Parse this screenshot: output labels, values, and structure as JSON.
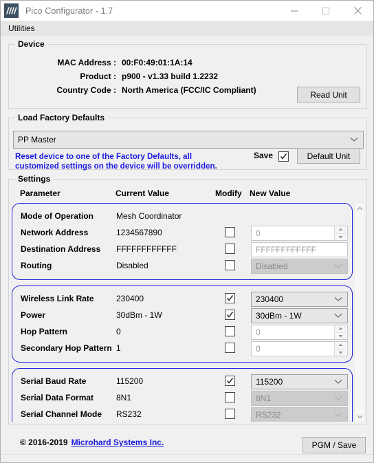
{
  "window": {
    "title": "Pico Configurator - 1.7",
    "logo_icon": "microhard-logo-icon",
    "minimize_icon": "minimize-icon",
    "maximize_icon": "maximize-icon",
    "close_icon": "close-icon"
  },
  "menubar": {
    "items": [
      {
        "label": "Utilities"
      }
    ]
  },
  "device": {
    "group_title": "Device",
    "rows": [
      {
        "label": "MAC Address :",
        "value": "00:F0:49:01:1A:14"
      },
      {
        "label": "Product :",
        "value": "p900 - v1.33 build 1.2232"
      },
      {
        "label": "Country Code :",
        "value": "North America (FCC/IC Compliant)"
      }
    ],
    "read_unit_button": "Read Unit"
  },
  "defaults": {
    "group_title": "Load Factory Defaults",
    "selected": "PP Master",
    "warning_line1": "Reset device to one of the Factory Defaults, all",
    "warning_line2": "customized settings on the device will be overridden.",
    "save_label": "Save",
    "save_checked": true,
    "default_unit_button": "Default Unit"
  },
  "settings": {
    "group_title": "Settings",
    "headers": {
      "parameter": "Parameter",
      "current_value": "Current Value",
      "modify": "Modify",
      "new_value": "New Value"
    },
    "groups": [
      {
        "rows": [
          {
            "name": "Mode of Operation",
            "current": "Mesh Coordinator",
            "has_modify": false,
            "checked": false,
            "control": "none",
            "new_value": ""
          },
          {
            "name": "Network Address",
            "current": "1234567890",
            "has_modify": true,
            "checked": false,
            "control": "spinner",
            "new_value": "0"
          },
          {
            "name": "Destination Address",
            "current": "FFFFFFFFFFFF",
            "has_modify": true,
            "checked": false,
            "control": "text",
            "new_value": "FFFFFFFFFFFF"
          },
          {
            "name": "Routing",
            "current": "Disabled",
            "has_modify": true,
            "checked": false,
            "control": "dropdown",
            "new_value": "Disabled"
          }
        ]
      },
      {
        "rows": [
          {
            "name": "Wireless Link Rate",
            "current": "230400",
            "has_modify": true,
            "checked": true,
            "control": "dropdown",
            "new_value": "230400"
          },
          {
            "name": "Power",
            "current": "30dBm - 1W",
            "has_modify": true,
            "checked": true,
            "control": "dropdown",
            "new_value": "30dBm - 1W"
          },
          {
            "name": "Hop Pattern",
            "current": "0",
            "has_modify": true,
            "checked": false,
            "control": "spinner",
            "new_value": "0"
          },
          {
            "name": "Secondary Hop Pattern",
            "current": "1",
            "has_modify": true,
            "checked": false,
            "control": "spinner",
            "new_value": "0"
          }
        ]
      },
      {
        "rows": [
          {
            "name": "Serial Baud Rate",
            "current": "115200",
            "has_modify": true,
            "checked": true,
            "control": "dropdown",
            "new_value": "115200"
          },
          {
            "name": "Serial Data Format",
            "current": "8N1",
            "has_modify": true,
            "checked": false,
            "control": "dropdown",
            "new_value": "8N1"
          },
          {
            "name": "Serial Channel Mode",
            "current": "RS232",
            "has_modify": true,
            "checked": false,
            "control": "dropdown",
            "new_value": "RS232"
          }
        ]
      }
    ],
    "scrollbar": {
      "up_icon": "chevron-up-icon",
      "down_icon": "chevron-down-icon"
    }
  },
  "footer": {
    "copyright": "© 2016-2019",
    "company_link": "Microhard Systems Inc.",
    "pgm_save_button": "PGM / Save"
  },
  "colors": {
    "accent_blue": "#1a1ae0",
    "group_border_blue": "#2222dd",
    "logo_bg": "#3c5060",
    "window_bg": "#f0f0f0"
  }
}
